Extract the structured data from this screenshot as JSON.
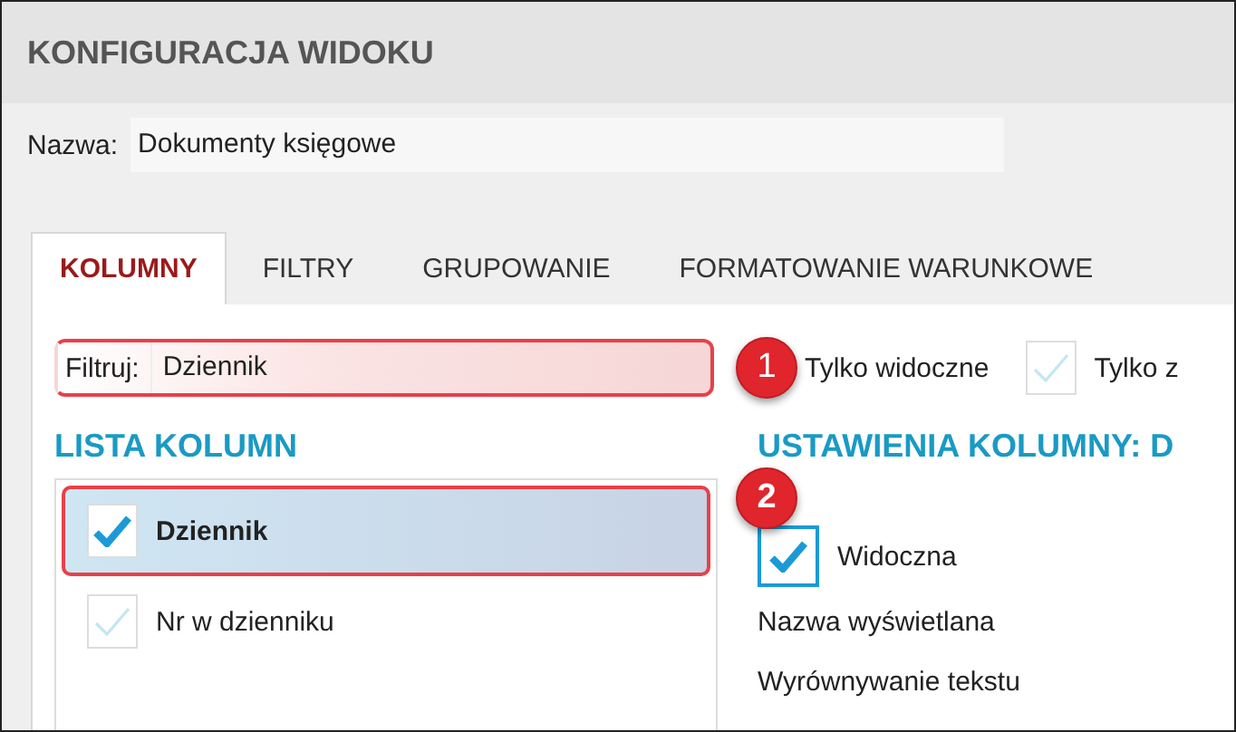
{
  "window": {
    "title": "KONFIGURACJA WIDOKU"
  },
  "name_field": {
    "label": "Nazwa:",
    "value": "Dokumenty księgowe"
  },
  "tabs": [
    {
      "label": "KOLUMNY",
      "selected": true
    },
    {
      "label": "FILTRY",
      "selected": false
    },
    {
      "label": "GRUPOWANIE",
      "selected": false
    },
    {
      "label": "FORMATOWANIE WARUNKOWE",
      "selected": false
    }
  ],
  "filter": {
    "label": "Filtruj:",
    "value": "Dziennik",
    "callout": "1"
  },
  "visible_only": {
    "label": "Tylko widoczne"
  },
  "other_option": {
    "label": "Tylko z",
    "checked": false
  },
  "column_list": {
    "title": "LISTA KOLUMN",
    "items": [
      {
        "label": "Dziennik",
        "checked": true,
        "selected": true,
        "callout": "2"
      },
      {
        "label": "Nr w dzienniku",
        "checked": false,
        "selected": false
      }
    ]
  },
  "settings": {
    "title": "USTAWIENIA KOLUMNY: D",
    "visible": {
      "label": "Widoczna",
      "checked": true
    },
    "fields": [
      "Nazwa wyświetlana",
      "Wyrównywanie tekstu"
    ]
  }
}
